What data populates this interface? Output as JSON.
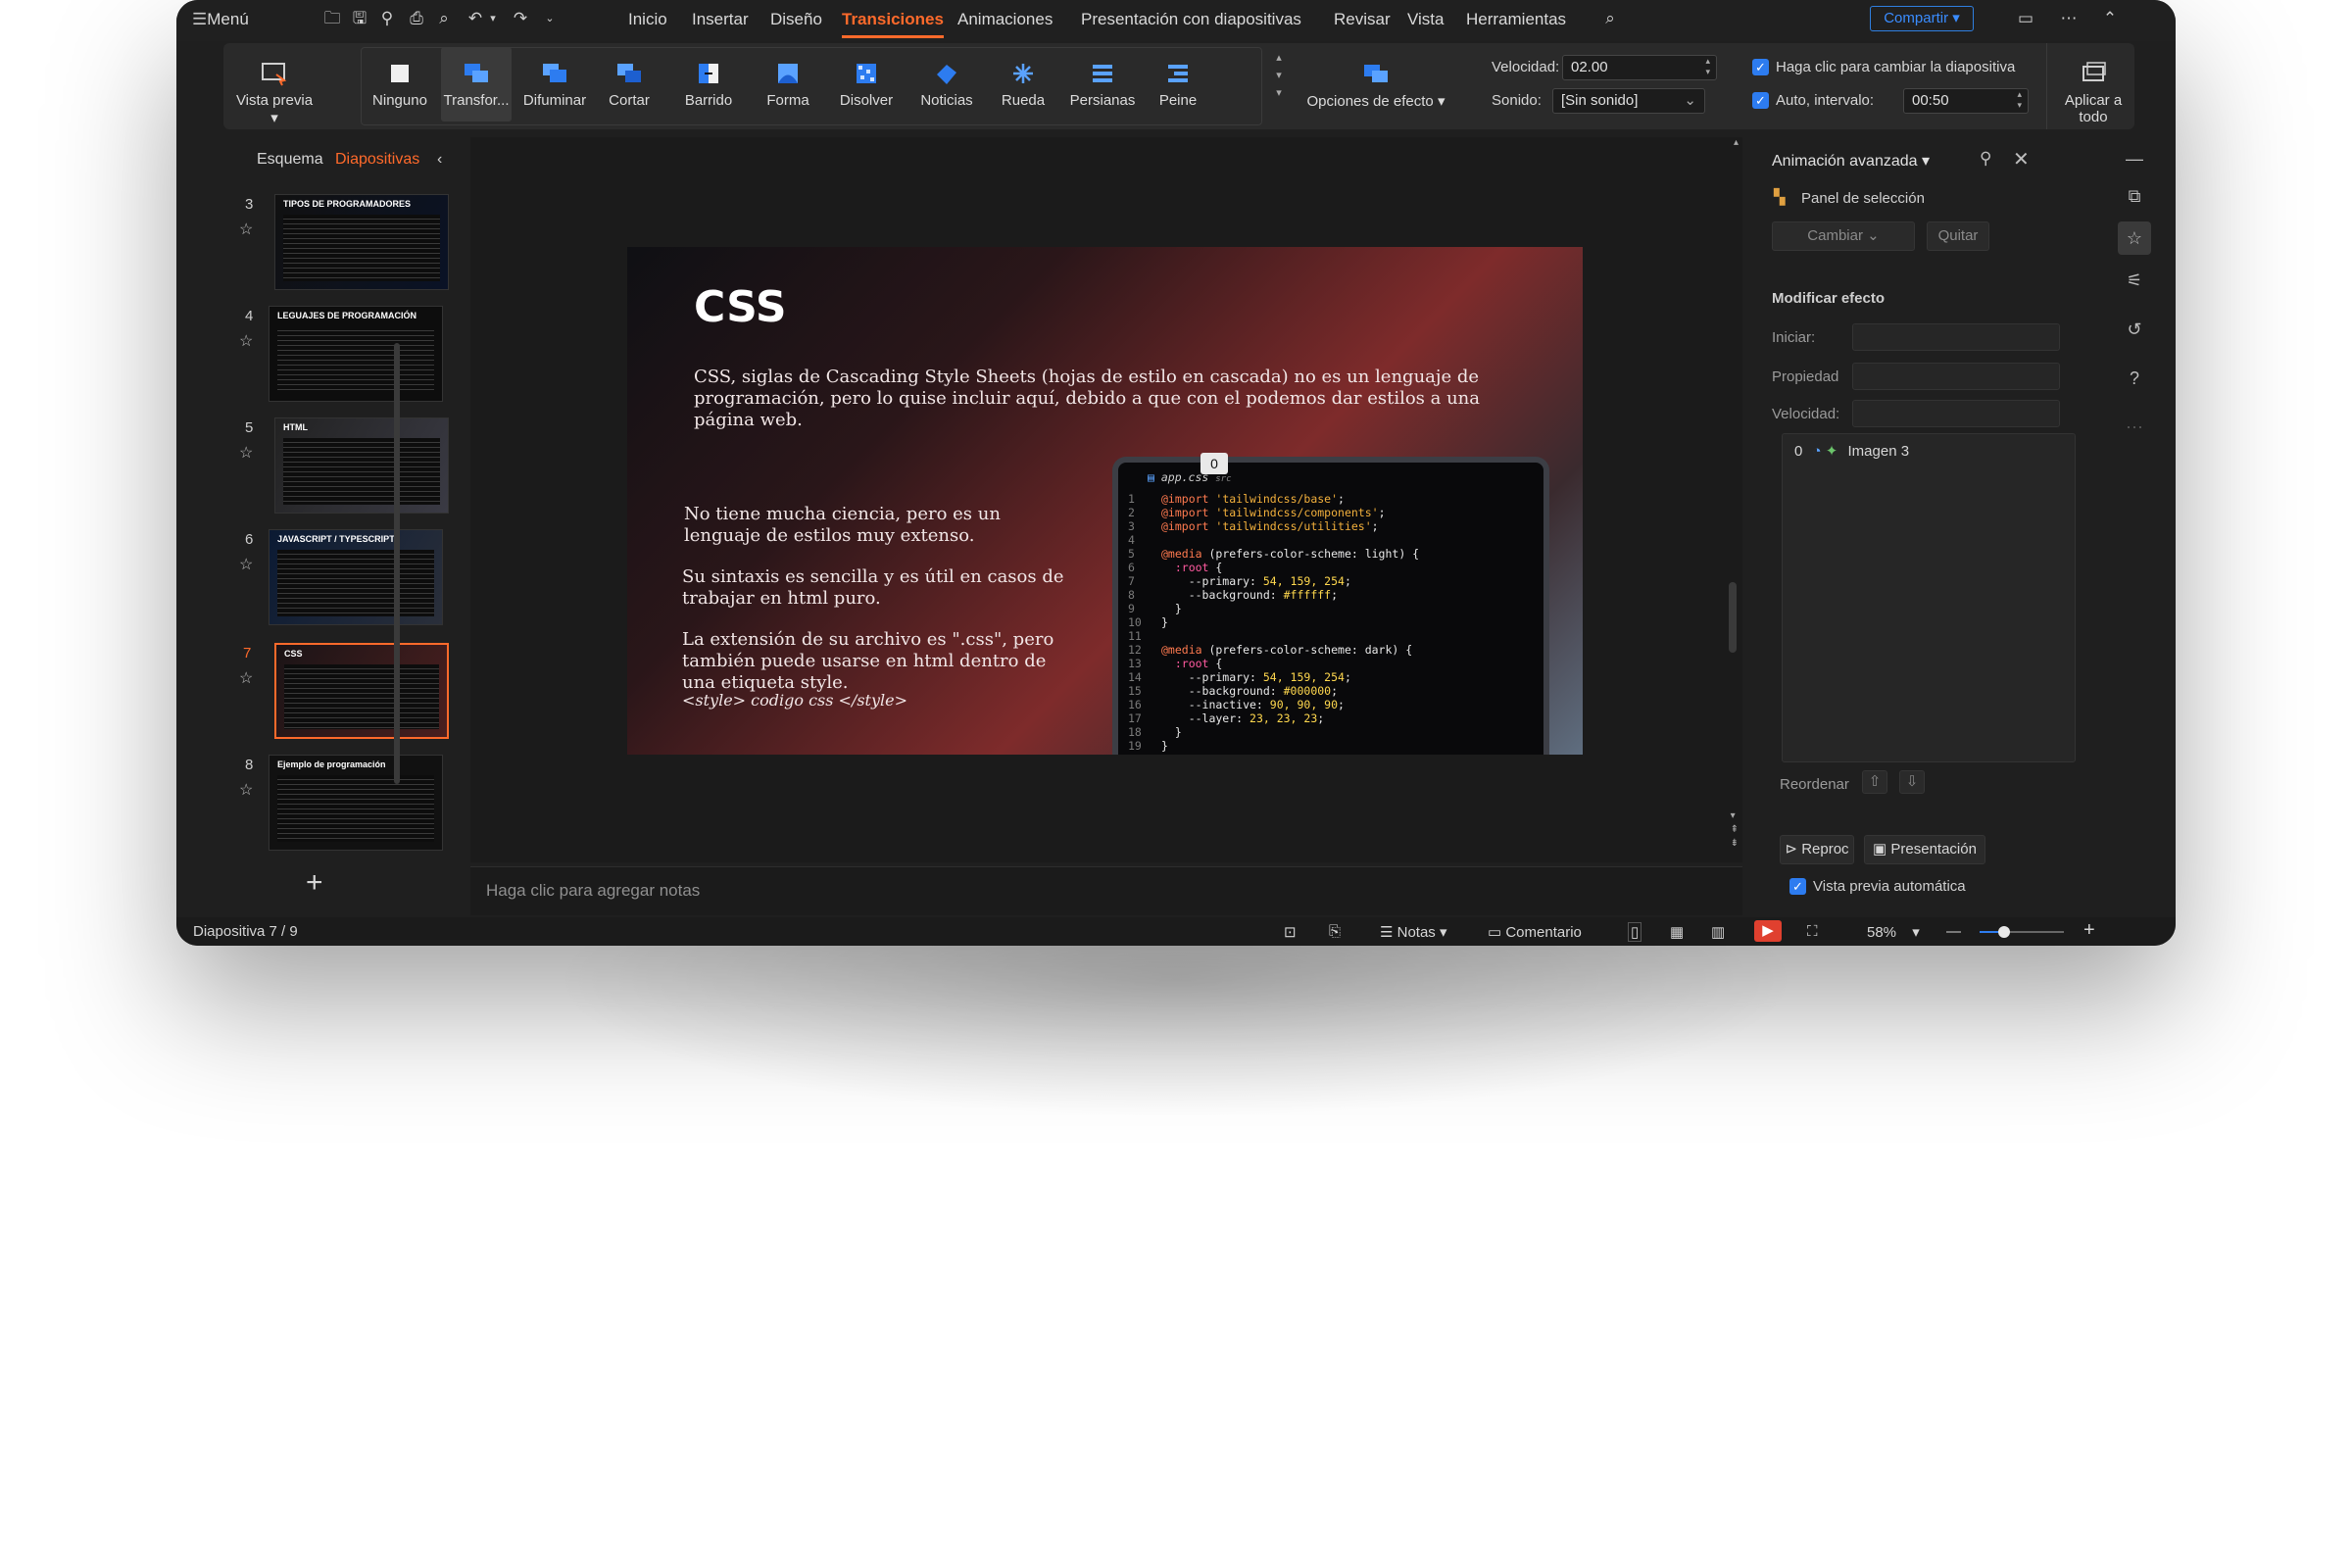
{
  "menubar": {
    "menu": "Menú",
    "tabs": [
      "Inicio",
      "Insertar",
      "Diseño",
      "Transiciones",
      "Animaciones",
      "Presentación con diapositivas",
      "Revisar",
      "Vista",
      "Herramientas"
    ],
    "active_tab": "Transiciones",
    "share": "Compartir"
  },
  "ribbon": {
    "preview": "Vista previa",
    "transitions": [
      "Ninguno",
      "Transfor...",
      "Difuminar",
      "Cortar",
      "Barrido",
      "Forma",
      "Disolver",
      "Noticias",
      "Rueda",
      "Persianas",
      "Peine"
    ],
    "selected_transition": "Transfor...",
    "effect_options": "Opciones de efecto",
    "speed_label": "Velocidad:",
    "speed_value": "02.00",
    "sound_label": "Sonido:",
    "sound_value": "[Sin sonido]",
    "click_advance": "Haga clic para cambiar la diapositiva",
    "auto_interval": "Auto, intervalo:",
    "interval_value": "00:50",
    "apply_all": "Aplicar a todo"
  },
  "left_panel": {
    "tab_outline": "Esquema",
    "tab_slides": "Diapositivas",
    "slides": [
      {
        "num": "3",
        "title": "TIPOS DE PROGRAMADORES"
      },
      {
        "num": "4",
        "title": "LEGUAJES DE PROGRAMACIÓN"
      },
      {
        "num": "5",
        "title": "HTML"
      },
      {
        "num": "6",
        "title": "JAVASCRIPT / TYPESCRIPT"
      },
      {
        "num": "7",
        "title": "CSS"
      },
      {
        "num": "8",
        "title": "Ejemplo de programación"
      }
    ],
    "current_slide": "7"
  },
  "slide": {
    "title": "CSS",
    "intro": "CSS, siglas de Cascading Style Sheets (hojas de estilo en cascada) no es un lenguaje de programación, pero lo quise incluir aquí, debido a que con el podemos dar estilos a una página web.",
    "p1": "No tiene mucha ciencia, pero es un lenguaje de estilos muy extenso.",
    "p2": "Su sintaxis es sencilla y es útil en casos de trabajar en html puro.",
    "p3": "La extensión de su archivo es \".css\", pero también puede usarse en html dentro de una etiqueta  style.",
    "p4": "<style> codigo css </style>",
    "badge": "0",
    "code_file": "app.css",
    "code_dir": "src",
    "code_lines": [
      "@import 'tailwindcss/base';",
      "@import 'tailwindcss/components';",
      "@import 'tailwindcss/utilities';",
      "",
      "@media (prefers-color-scheme: light) {",
      "  :root {",
      "    --primary: 54, 159, 254;",
      "    --background: #ffffff;",
      "  }",
      "}",
      "",
      "@media (prefers-color-scheme: dark) {",
      "  :root {",
      "    --primary: 54, 159, 254;",
      "    --background: #000000;",
      "    --inactive: 90, 90, 90;",
      "    --layer: 23, 23, 23;",
      "  }",
      "}"
    ]
  },
  "notes_placeholder": "Haga clic para agregar notas",
  "pane": {
    "title": "Animación avanzada",
    "selection_panel": "Panel de selección",
    "change": "Cambiar",
    "remove": "Quitar",
    "modify_effect": "Modificar efecto",
    "start": "Iniciar:",
    "property": "Propiedad",
    "speed": "Velocidad:",
    "anim_item_index": "0",
    "anim_item": "Imagen 3",
    "reorder": "Reordenar",
    "play": "Reproc",
    "presentation": "Presentación",
    "auto_preview": "Vista previa automática"
  },
  "status": {
    "slide_label": "Diapositiva",
    "slide_pos": "7 / 9",
    "notes": "Notas",
    "comment": "Comentario",
    "zoom": "58%",
    "zoom_level": 0.58
  },
  "colors": {
    "accent": "#ff6a2b",
    "share_blue": "#2f7fe0",
    "checkbox": "#2d7cf0",
    "window_bg": "#1f1f1f"
  }
}
